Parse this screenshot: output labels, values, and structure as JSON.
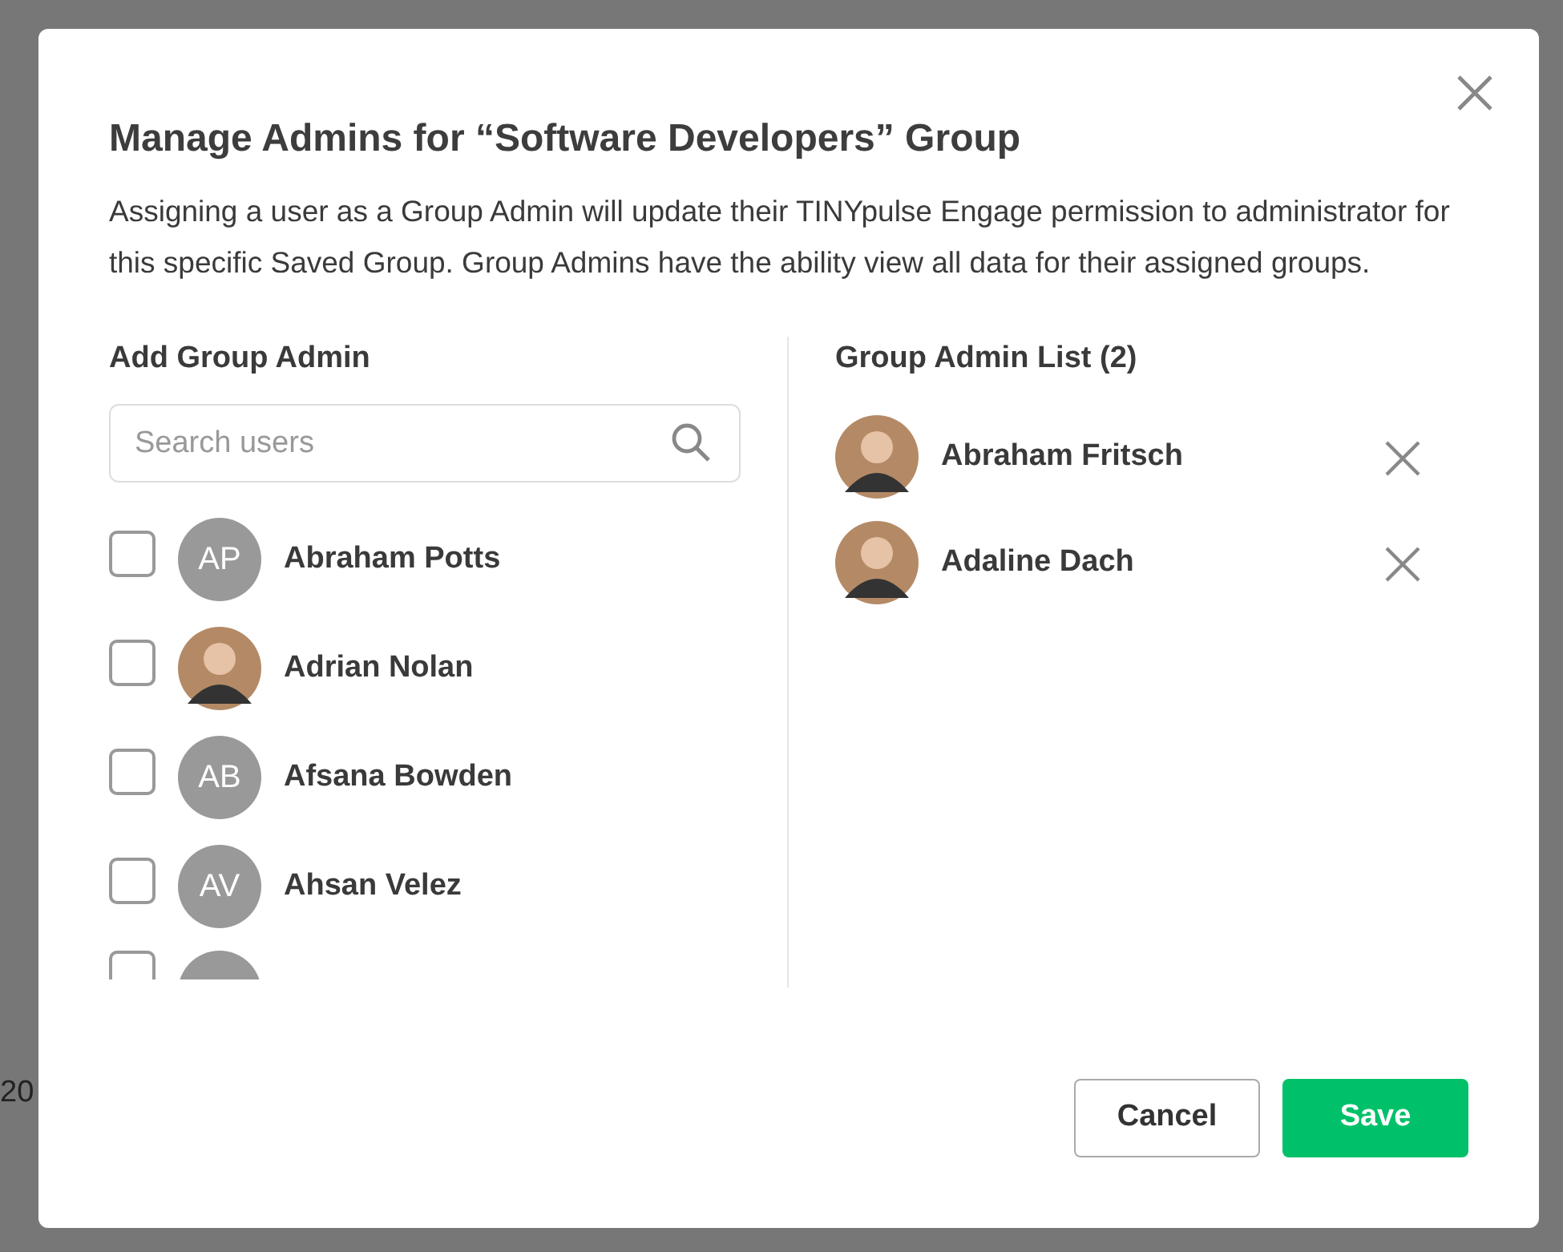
{
  "background_text": "20",
  "dialog": {
    "title": "Manage Admins for “Software Developers” Group",
    "description": "Assigning a user as a Group Admin will update their TINYpulse Engage permission to administrator for this specific Saved Group. Group Admins have the ability view all data for their assigned groups.",
    "add_panel": {
      "heading": "Add Group Admin",
      "search": {
        "placeholder": "Search users"
      },
      "users": [
        {
          "name": "Abraham Potts",
          "kind": "initials",
          "initials": "AP",
          "checked": false
        },
        {
          "name": "Adrian Nolan",
          "kind": "photo",
          "checked": false
        },
        {
          "name": "Afsana Bowden",
          "kind": "initials",
          "initials": "AB",
          "checked": false
        },
        {
          "name": "Ahsan Velez",
          "kind": "initials",
          "initials": "AV",
          "checked": false
        }
      ],
      "partial_user": {
        "checked": false
      }
    },
    "admin_panel": {
      "heading": "Group Admin List (2)",
      "admins": [
        {
          "name": "Abraham Fritsch"
        },
        {
          "name": "Adaline Dach"
        }
      ]
    },
    "buttons": [
      {
        "label": "Cancel",
        "kind": "secondary"
      },
      {
        "label": "Save",
        "kind": "primary"
      }
    ]
  }
}
